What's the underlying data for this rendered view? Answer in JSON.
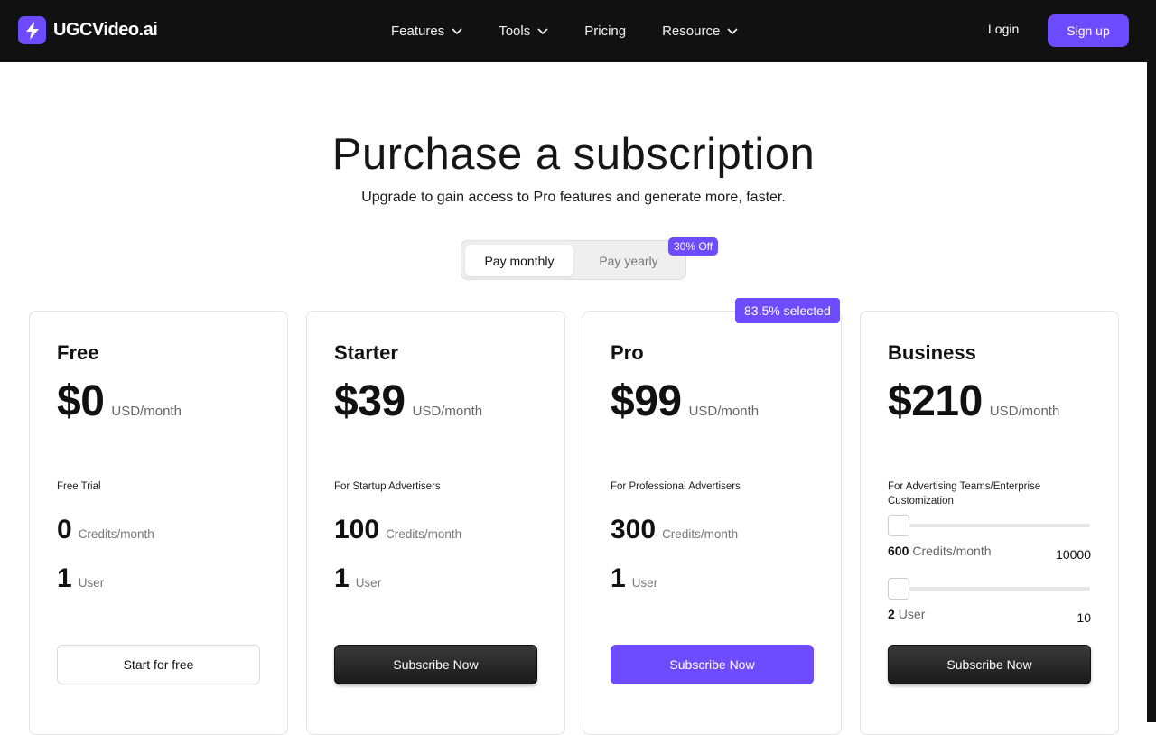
{
  "header": {
    "brand": "UGCVideo.ai",
    "nav": [
      {
        "label": "Features",
        "has_dropdown": true
      },
      {
        "label": "Tools",
        "has_dropdown": true
      },
      {
        "label": "Pricing",
        "has_dropdown": false
      },
      {
        "label": "Resource",
        "has_dropdown": true
      }
    ],
    "login": "Login",
    "signup": "Sign up"
  },
  "hero": {
    "title": "Purchase a subscription",
    "subtitle": "Upgrade to gain access to Pro features and generate more, faster."
  },
  "billing": {
    "monthly": "Pay monthly",
    "yearly": "Pay yearly",
    "discount_badge": "30% Off",
    "selected": "monthly"
  },
  "plans": [
    {
      "name": "Free",
      "price": "$0",
      "unit": "USD/month",
      "description": "Free Trial",
      "credits": "0",
      "credits_unit": "Credits/month",
      "users": "1",
      "users_unit": "User",
      "button": "Start for free"
    },
    {
      "name": "Starter",
      "price": "$39",
      "unit": "USD/month",
      "description": "For Startup Advertisers",
      "credits": "100",
      "credits_unit": "Credits/month",
      "users": "1",
      "users_unit": "User",
      "button": "Subscribe Now"
    },
    {
      "name": "Pro",
      "price": "$99",
      "unit": "USD/month",
      "description": "For Professional Advertisers",
      "credits": "300",
      "credits_unit": "Credits/month",
      "users": "1",
      "users_unit": "User",
      "button": "Subscribe Now",
      "badge": "83.5% selected"
    },
    {
      "name": "Business",
      "price": "$210",
      "unit": "USD/month",
      "description": "For Advertising Teams/Enterprise Customization",
      "credits": "600",
      "credits_unit": "Credits/month",
      "credits_max": "10000",
      "users": "2",
      "users_unit": "User",
      "users_max": "10",
      "button": "Subscribe Now"
    }
  ],
  "colors": {
    "accent": "#6d4bff",
    "header_bg": "#111111",
    "dark_button": "#1f1f1f"
  }
}
